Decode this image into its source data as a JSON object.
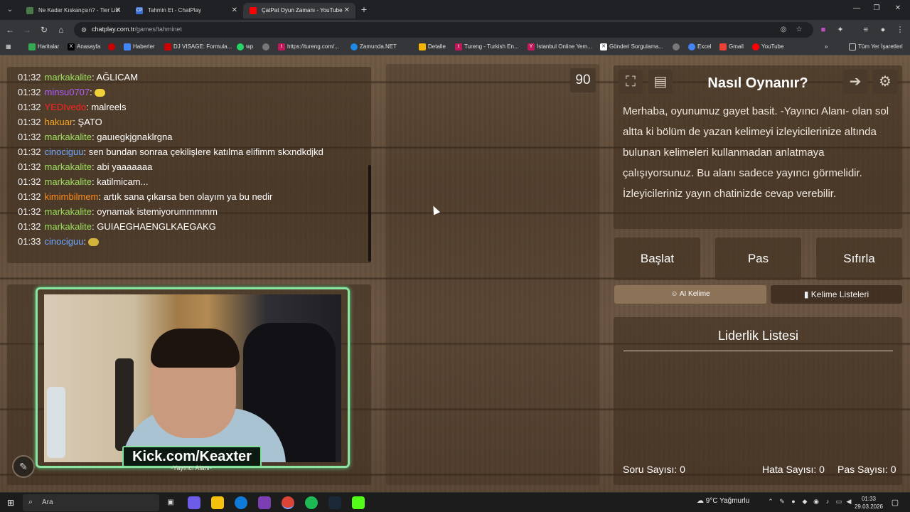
{
  "browser": {
    "tabs": [
      {
        "title": "Ne Kadar Kıskançsın? - Tier List",
        "active": false,
        "favicon_color": "#4a7a4a"
      },
      {
        "title": "Tahmin Et - ChatPlay",
        "active": false,
        "favicon_color": "#3b6fd6",
        "favicon_text": "CP"
      },
      {
        "title": "ÇatPat Oyun Zamanı - YouTube",
        "active": true,
        "favicon_color": "#ff0000"
      }
    ],
    "tab_close": "✕",
    "new_tab": "+",
    "window_controls": {
      "minimize": "—",
      "restore": "❐",
      "close": "✕"
    },
    "url_domain": "chatplay.com.tr",
    "url_path": "/games/tahminet",
    "bookmarks": [
      {
        "label": "Haritalar",
        "color": "#34a853"
      },
      {
        "label": "Anasayfa",
        "color": "#000000",
        "glyph": "X"
      },
      {
        "label": "",
        "color": "#cc0000"
      },
      {
        "label": "Haberler",
        "color": "#4285f4"
      },
      {
        "label": "DJ VISAGE: Formula...",
        "color": "#cc0000"
      },
      {
        "label": "wp",
        "color": "#25d366"
      },
      {
        "label": "",
        "color": "#777777"
      },
      {
        "label": "https://tureng.com/...",
        "color": "#c2185b",
        "glyph": "t"
      },
      {
        "label": "Zamunda.NET",
        "color": "#1e88e5"
      },
      {
        "label": "Detalle",
        "color": "#f4b400"
      },
      {
        "label": "Tureng - Turkish En...",
        "color": "#c2185b",
        "glyph": "t"
      },
      {
        "label": "İstanbul Online Yem...",
        "color": "#c2185b",
        "glyph": "Y"
      },
      {
        "label": "Gönderi Sorgulama...",
        "color": "#ffffff"
      },
      {
        "label": "",
        "color": "#777777"
      },
      {
        "label": "Excel",
        "color": "#4285f4"
      },
      {
        "label": "Gmail",
        "color": "#ea4335"
      },
      {
        "label": "YouTube",
        "color": "#ff0000"
      }
    ],
    "all_bookmarks": "Tüm Yer İşaretleri"
  },
  "chat": {
    "messages": [
      {
        "time": "01:32",
        "user": "markakalite",
        "color": "#9be15d",
        "text": ": AĞLICAM"
      },
      {
        "time": "01:32",
        "user": "minsu0707",
        "color": "#b05cff",
        "text": ":",
        "emote": "#f0d03a"
      },
      {
        "time": "01:32",
        "user": "YEDIvedo",
        "color": "#ff2222",
        "text": ": malreels"
      },
      {
        "time": "01:32",
        "user": "hakuar",
        "color": "#f5a623",
        "text": ": ŞATO"
      },
      {
        "time": "01:32",
        "user": "markakalite",
        "color": "#9be15d",
        "text": ": gauıegkjgnaklrgna"
      },
      {
        "time": "01:32",
        "user": "cinociguu",
        "color": "#6fa8ff",
        "text": ": sen bundan sonraa çekilişlere katılma elifimm skxndkdjkd"
      },
      {
        "time": "01:32",
        "user": "markakalite",
        "color": "#9be15d",
        "text": ": abi yaaaaaaa"
      },
      {
        "time": "01:32",
        "user": "markakalite",
        "color": "#9be15d",
        "text": ": katilmicam..."
      },
      {
        "time": "01:32",
        "user": "kimimbilmem",
        "color": "#ff8c1a",
        "text": ": artık sana çıkarsa ben olayım ya bu nedir"
      },
      {
        "time": "01:32",
        "user": "markakalite",
        "color": "#9be15d",
        "text": ": oynamak istemiyorummmmm"
      },
      {
        "time": "01:32",
        "user": "markakalite",
        "color": "#9be15d",
        "text": ": GUIAEGHAENGLKAEGAKG"
      },
      {
        "time": "01:33",
        "user": "cinociguu",
        "color": "#6fa8ff",
        "text": ":",
        "emote": "#d4b33a"
      }
    ]
  },
  "webcam": {
    "overlay": "Kick.com/Keaxter",
    "subtitle": "-Yayıncı Alanı-"
  },
  "game": {
    "timer": "90",
    "howto_title": "Nasıl Oynanır?",
    "howto_text": "Merhaba, oyunumuz gayet basit. -Yayıncı Alanı- olan sol altta ki bölüm de yazan kelimeyi izleyicilerinize altında bulunan kelimeleri kullanmadan anlatmaya çalışıyorsunuz. Bu alanı sadece yayıncı görmelidir. İzleyicileriniz yayın chatinizde cevap verebilir.",
    "buttons": {
      "start": "Başlat",
      "pass": "Pas",
      "reset": "Sıfırla"
    },
    "ai_word": "AI Kelime",
    "word_lists": "Kelime Listeleri",
    "leaderboard_title": "Liderlik Listesi",
    "stats": {
      "questions": "Soru Sayısı: 0",
      "errors": "Hata Sayısı: 0",
      "passes": "Pas Sayısı: 0"
    }
  },
  "taskbar": {
    "search_placeholder": "Ara",
    "weather": "9°C  Yağmurlu",
    "time": "01:33",
    "date": "29.03.2026"
  }
}
